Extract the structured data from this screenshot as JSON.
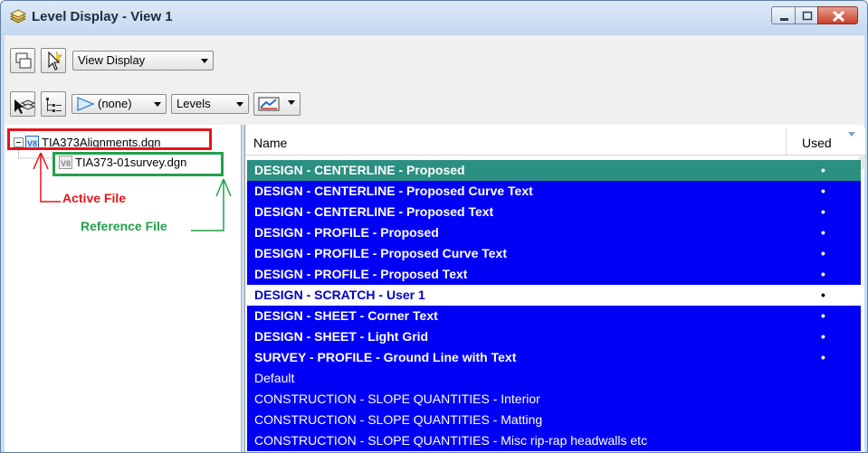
{
  "window": {
    "title": "Level Display - View 1",
    "icon": "layers-icon"
  },
  "toolbar": {
    "view_display": "View Display",
    "filter_value": "(none)",
    "levels_combo": "Levels"
  },
  "tree": {
    "root": "TIA373Alignments.dgn",
    "child": "TIA373-01survey.dgn"
  },
  "annotations": {
    "active": "Active File",
    "reference": "Reference File"
  },
  "table": {
    "col_name": "Name",
    "col_used": "Used",
    "used_mark": "•",
    "rows": [
      {
        "name": "DESIGN - CENTERLINE - Proposed",
        "used": true,
        "state": "sel-active"
      },
      {
        "name": "DESIGN - CENTERLINE - Proposed Curve Text",
        "used": true,
        "state": "sel-blue"
      },
      {
        "name": "DESIGN - CENTERLINE - Proposed Text",
        "used": true,
        "state": "sel-blue"
      },
      {
        "name": "DESIGN - PROFILE - Proposed",
        "used": true,
        "state": "sel-blue"
      },
      {
        "name": "DESIGN - PROFILE - Proposed Curve Text",
        "used": true,
        "state": "sel-blue"
      },
      {
        "name": "DESIGN - PROFILE - Proposed Text",
        "used": true,
        "state": "sel-blue"
      },
      {
        "name": "DESIGN - SCRATCH - User 1",
        "used": true,
        "state": "sel-white"
      },
      {
        "name": "DESIGN - SHEET - Corner Text",
        "used": true,
        "state": "sel-blue"
      },
      {
        "name": "DESIGN - SHEET - Light Grid",
        "used": true,
        "state": "sel-blue"
      },
      {
        "name": "SURVEY - PROFILE - Ground Line with Text",
        "used": true,
        "state": "sel-blue"
      },
      {
        "name": "Default",
        "used": false,
        "state": "sel-blue-plain"
      },
      {
        "name": "CONSTRUCTION - SLOPE QUANTITIES - Interior",
        "used": false,
        "state": "sel-blue-plain"
      },
      {
        "name": "CONSTRUCTION - SLOPE QUANTITIES - Matting",
        "used": false,
        "state": "sel-blue-plain"
      },
      {
        "name": "CONSTRUCTION - SLOPE QUANTITIES - Misc rip-rap headwalls etc",
        "used": false,
        "state": "sel-blue-plain"
      }
    ]
  },
  "colors": {
    "selection_blue": "#0000f5",
    "active_row": "#2b8f82",
    "annotation_red": "#e8141c",
    "annotation_green": "#21a14a"
  }
}
